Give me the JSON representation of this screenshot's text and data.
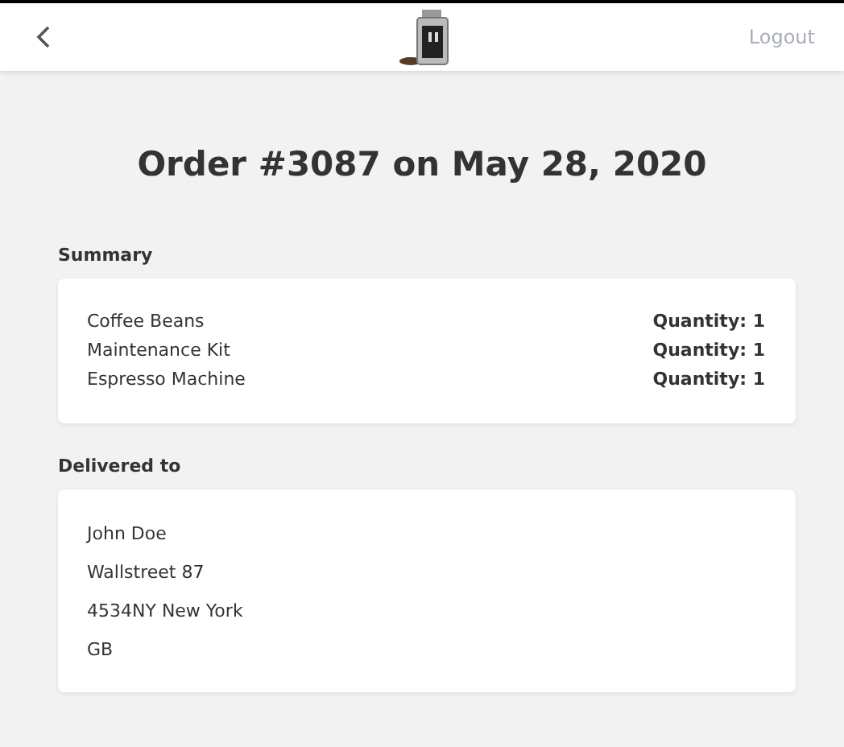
{
  "header": {
    "logout": "Logout"
  },
  "title": "Order #3087 on May 28, 2020",
  "summary": {
    "heading": "Summary",
    "items": [
      {
        "name": "Coffee Beans",
        "quantity": "Quantity: 1"
      },
      {
        "name": "Maintenance Kit",
        "quantity": "Quantity: 1"
      },
      {
        "name": "Espresso Machine",
        "quantity": "Quantity: 1"
      }
    ]
  },
  "delivery": {
    "heading": "Delivered to",
    "lines": [
      "John Doe",
      "Wallstreet 87",
      "4534NY New York",
      "GB"
    ]
  }
}
